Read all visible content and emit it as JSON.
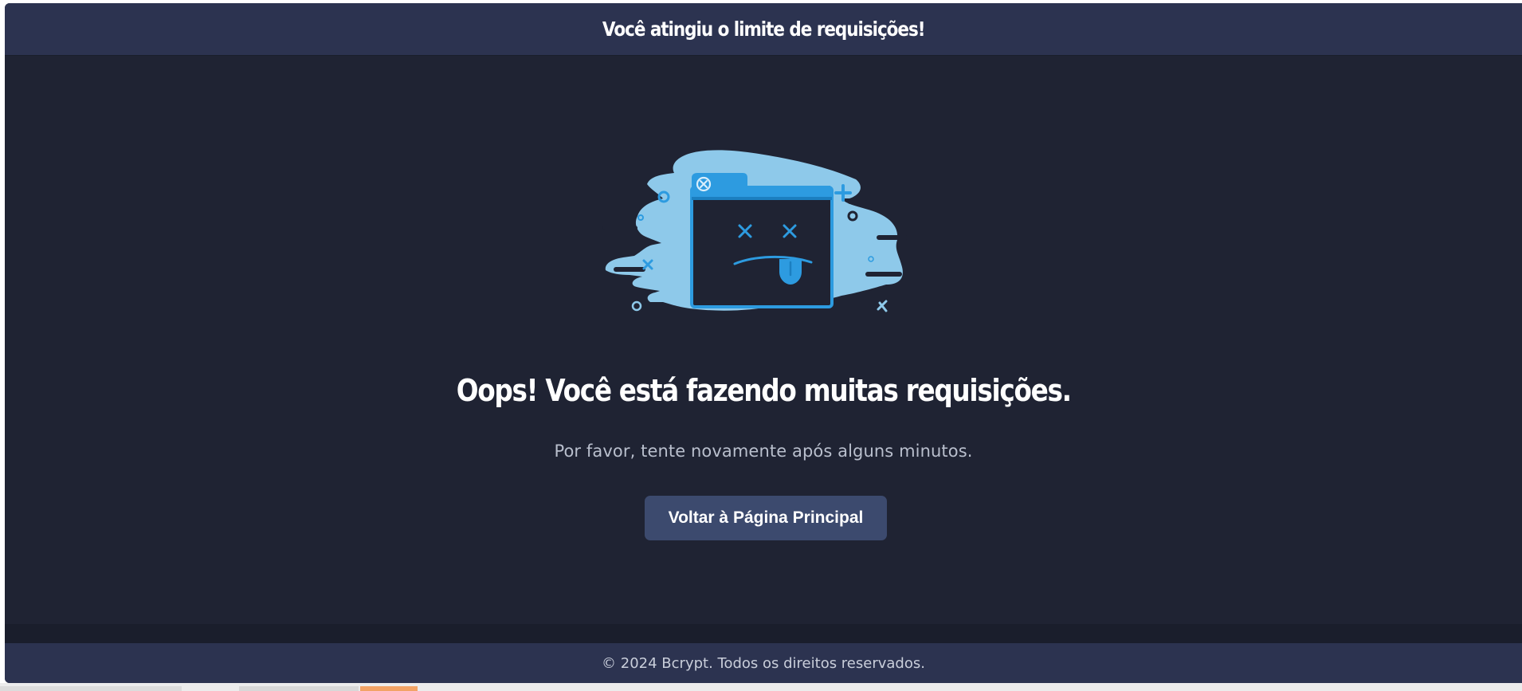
{
  "header": {
    "title": "Você atingiu o limite de requisições!"
  },
  "main": {
    "illustration_icon": "sad-browser-window-icon",
    "headline": "Oops! Você está fazendo muitas requisições.",
    "subtext": "Por favor, tente novamente após alguns minutos.",
    "home_button_label": "Voltar à Página Principal"
  },
  "footer": {
    "text": "© 2024 Bcrypt. Todos os direitos reservados."
  },
  "colors": {
    "background": "#1f2333",
    "header_bar": "#2c3350",
    "button": "#3c4a6e",
    "illustration_blue": "#8ec9ea",
    "illustration_accent": "#2d9be0"
  }
}
